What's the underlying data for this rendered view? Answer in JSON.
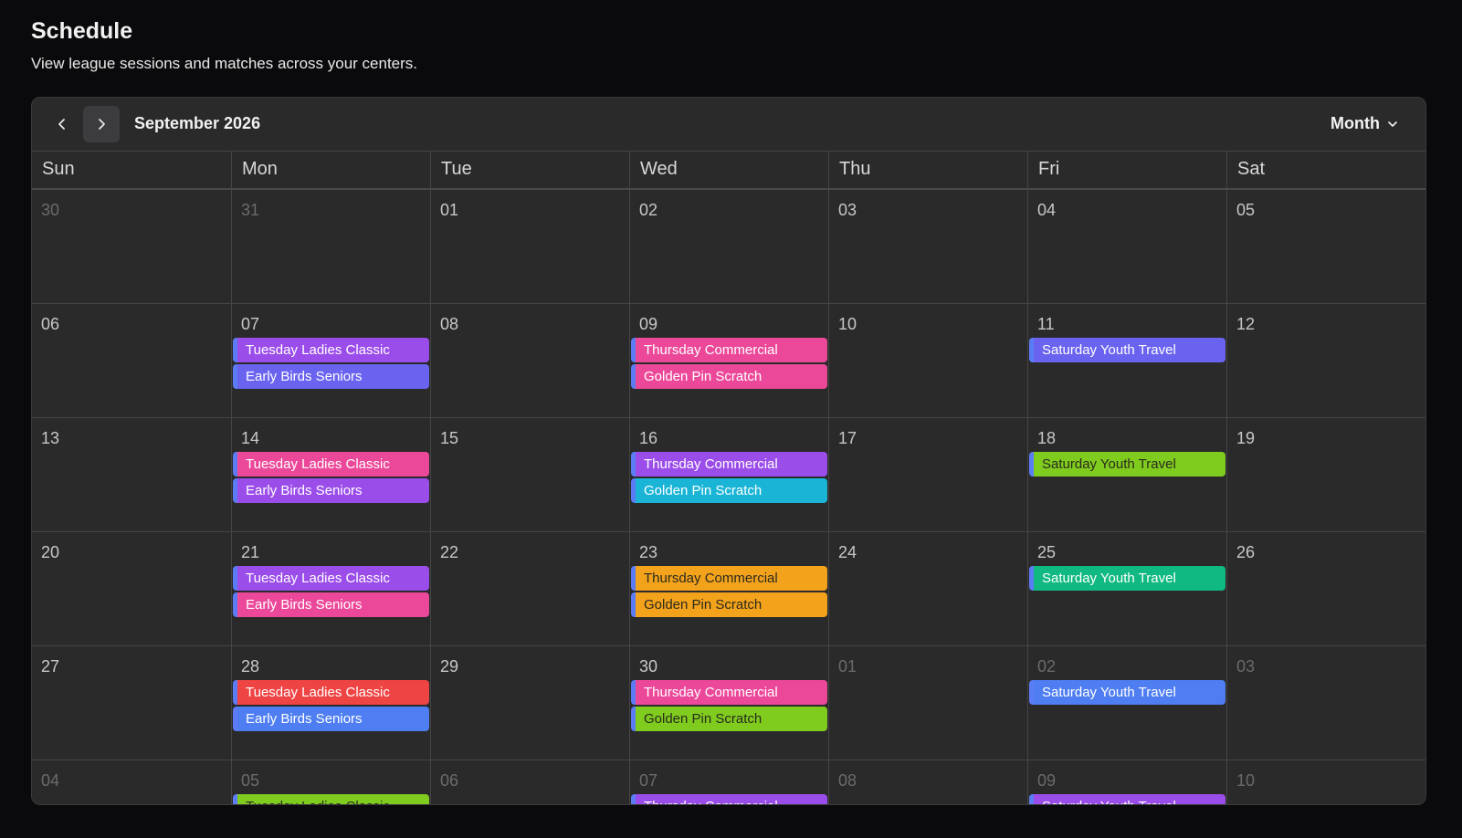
{
  "page": {
    "title": "Schedule",
    "subtitle": "View league sessions and matches across your centers."
  },
  "toolbar": {
    "prev_icon": "chevron-left-icon",
    "next_icon": "chevron-right-icon",
    "month_label": "September 2026",
    "view_label": "Month",
    "view_icon": "chevron-down-icon"
  },
  "weekdays": [
    "Sun",
    "Mon",
    "Tue",
    "Wed",
    "Thu",
    "Fri",
    "Sat"
  ],
  "colors": {
    "purple": "#9b4dea",
    "indigo": "#6a63ef",
    "pink": "#ec4899",
    "cyan": "#1ab5d6",
    "lime": "#7fcc1f",
    "orange": "#f3a21c",
    "green": "#10b981",
    "red": "#ef4444",
    "blue": "#4f7ef2",
    "accent_bar": "#5b7cf5"
  },
  "weeks": [
    [
      {
        "date": "30",
        "outside": true,
        "events": []
      },
      {
        "date": "31",
        "outside": true,
        "events": []
      },
      {
        "date": "01",
        "events": []
      },
      {
        "date": "02",
        "events": []
      },
      {
        "date": "03",
        "events": []
      },
      {
        "date": "04",
        "events": []
      },
      {
        "date": "05",
        "events": []
      }
    ],
    [
      {
        "date": "06",
        "events": []
      },
      {
        "date": "07",
        "events": [
          {
            "title": "Tuesday Ladies Classic",
            "color": "purple"
          },
          {
            "title": "Early Birds Seniors",
            "color": "indigo"
          }
        ]
      },
      {
        "date": "08",
        "events": []
      },
      {
        "date": "09",
        "events": [
          {
            "title": "Thursday Commercial",
            "color": "pink"
          },
          {
            "title": "Golden Pin Scratch",
            "color": "pink"
          }
        ]
      },
      {
        "date": "10",
        "events": []
      },
      {
        "date": "11",
        "events": [
          {
            "title": "Saturday Youth Travel",
            "color": "indigo"
          }
        ]
      },
      {
        "date": "12",
        "events": []
      }
    ],
    [
      {
        "date": "13",
        "events": []
      },
      {
        "date": "14",
        "events": [
          {
            "title": "Tuesday Ladies Classic",
            "color": "pink"
          },
          {
            "title": "Early Birds Seniors",
            "color": "purple"
          }
        ]
      },
      {
        "date": "15",
        "events": []
      },
      {
        "date": "16",
        "events": [
          {
            "title": "Thursday Commercial",
            "color": "purple"
          },
          {
            "title": "Golden Pin Scratch",
            "color": "cyan"
          }
        ]
      },
      {
        "date": "17",
        "events": []
      },
      {
        "date": "18",
        "events": [
          {
            "title": "Saturday Youth Travel",
            "color": "lime"
          }
        ]
      },
      {
        "date": "19",
        "events": []
      }
    ],
    [
      {
        "date": "20",
        "events": []
      },
      {
        "date": "21",
        "events": [
          {
            "title": "Tuesday Ladies Classic",
            "color": "purple"
          },
          {
            "title": "Early Birds Seniors",
            "color": "pink"
          }
        ]
      },
      {
        "date": "22",
        "events": []
      },
      {
        "date": "23",
        "events": [
          {
            "title": "Thursday Commercial",
            "color": "orange"
          },
          {
            "title": "Golden Pin Scratch",
            "color": "orange"
          }
        ]
      },
      {
        "date": "24",
        "events": []
      },
      {
        "date": "25",
        "events": [
          {
            "title": "Saturday Youth Travel",
            "color": "green"
          }
        ]
      },
      {
        "date": "26",
        "events": []
      }
    ],
    [
      {
        "date": "27",
        "events": []
      },
      {
        "date": "28",
        "events": [
          {
            "title": "Tuesday Ladies Classic",
            "color": "red"
          },
          {
            "title": "Early Birds Seniors",
            "color": "blue"
          }
        ]
      },
      {
        "date": "29",
        "events": []
      },
      {
        "date": "30",
        "events": [
          {
            "title": "Thursday Commercial",
            "color": "pink"
          },
          {
            "title": "Golden Pin Scratch",
            "color": "lime"
          }
        ]
      },
      {
        "date": "01",
        "outside": true,
        "events": []
      },
      {
        "date": "02",
        "outside": true,
        "events": [
          {
            "title": "Saturday Youth Travel",
            "color": "blue"
          }
        ]
      },
      {
        "date": "03",
        "outside": true,
        "events": []
      }
    ],
    [
      {
        "date": "04",
        "outside": true,
        "events": []
      },
      {
        "date": "05",
        "outside": true,
        "events": [
          {
            "title": "Tuesday Ladies Classic",
            "color": "lime"
          }
        ]
      },
      {
        "date": "06",
        "outside": true,
        "events": []
      },
      {
        "date": "07",
        "outside": true,
        "events": [
          {
            "title": "Thursday Commercial",
            "color": "purple"
          }
        ]
      },
      {
        "date": "08",
        "outside": true,
        "events": []
      },
      {
        "date": "09",
        "outside": true,
        "events": [
          {
            "title": "Saturday Youth Travel",
            "color": "purple"
          }
        ]
      },
      {
        "date": "10",
        "outside": true,
        "events": []
      }
    ]
  ]
}
